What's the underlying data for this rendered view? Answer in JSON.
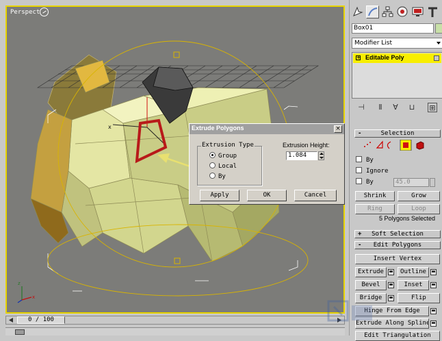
{
  "viewport": {
    "label": "Perspect",
    "border_color": "#e8d400",
    "background": "#7c7c79"
  },
  "dialog": {
    "title": "Extrude Polygons",
    "close_label": "×",
    "extrusion_type": {
      "title": "Extrusion Type",
      "options": [
        "Group",
        "Local",
        "By"
      ],
      "selected": "Group"
    },
    "extrusion_height": {
      "label": "Extrusion Height:",
      "value": "1.084"
    },
    "buttons": {
      "apply": "Apply",
      "ok": "OK",
      "cancel": "Cancel"
    }
  },
  "command_panel": {
    "tab_icons": [
      "create-icon",
      "modify-icon",
      "hierarchy-icon",
      "motion-icon",
      "display-icon",
      "utilities-icon"
    ],
    "object_name": "Box01",
    "object_color": "#c8e0a8",
    "modifier_list": "Modifier List",
    "stack": {
      "plus": "+",
      "item": "Editable Poly",
      "highlight": "#f8ee00"
    },
    "stack_tools": [
      "pin-stack-icon",
      "show-end-result-icon",
      "make-unique-icon",
      "remove-modifier-icon",
      "configure-sets-icon"
    ],
    "selection": {
      "header": "Selection",
      "sign": "-",
      "subobject_icons": [
        "vertex-icon",
        "edge-icon",
        "border-icon",
        "polygon-icon",
        "element-icon"
      ],
      "active_subobject": "polygon-icon",
      "checkboxes": [
        "By",
        "Ignore",
        "By"
      ],
      "angle_value": "45.0",
      "buttons": [
        "Shrink",
        "Grow",
        "Ring",
        "Loop"
      ],
      "selected_count": "5 Polygons Selected"
    },
    "soft_selection": {
      "header": "Soft Selection",
      "sign": "+"
    },
    "edit_polygons": {
      "header": "Edit Polygons",
      "sign": "-",
      "insert_vertex": "Insert Vertex",
      "extrude": "Extrude",
      "outline": "Outline",
      "bevel": "Bevel",
      "inset": "Inset",
      "bridge": "Bridge",
      "flip": "Flip",
      "hinge_from_edge": "Hinge From Edge",
      "extrude_along_spline": "Extrude Along Spline",
      "edit_triangulation": "Edit Triangulation"
    }
  },
  "time_slider": {
    "current": "0 / 100"
  },
  "accent_color": "#c01818"
}
